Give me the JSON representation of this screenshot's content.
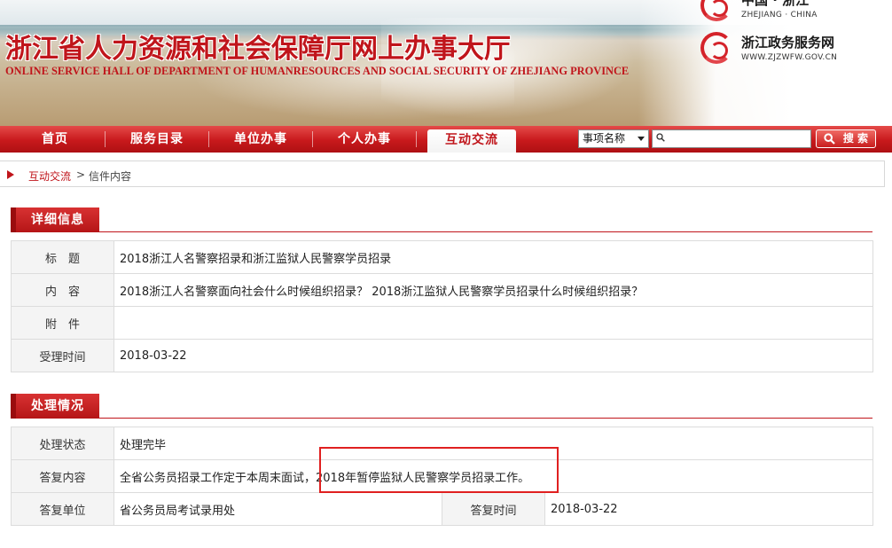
{
  "header": {
    "title_cn": "浙江省人力资源和社会保障厅网上办事大厅",
    "title_en": "ONLINE SERVICE HALL OF DEPARTMENT OF HUMANRESOURCES AND SOCIAL SECURITY OF ZHEJIANG PROVINCE",
    "logo_top": {
      "cn": "中国 · 浙江",
      "en": "ZHEJIANG · CHINA"
    },
    "logo_mid": {
      "cn": "浙江政务服务网",
      "en": "WWW.ZJZWFW.GOV.CN"
    }
  },
  "nav": {
    "items": [
      {
        "label": "首页"
      },
      {
        "label": "服务目录"
      },
      {
        "label": "单位办事"
      },
      {
        "label": "个人办事"
      },
      {
        "label": "互动交流"
      }
    ],
    "active": "互动交流",
    "search_type": "事项名称",
    "search_placeholder": "",
    "search_button": "搜 索"
  },
  "breadcrumb": {
    "link": "互动交流",
    "separator": ">",
    "current": "信件内容"
  },
  "details": {
    "section_title": "详细信息",
    "rows": [
      {
        "label": "标　题",
        "value": "2018浙江人名警察招录和浙江监狱人民警察学员招录"
      },
      {
        "label": "内　容",
        "value": "2018浙江人名警察面向社会什么时候组织招录？ 2018浙江监狱人民警察学员招录什么时候组织招录？"
      },
      {
        "label": "附　件",
        "value": ""
      },
      {
        "label": "受理时间",
        "value": "2018-03-22"
      }
    ]
  },
  "handling": {
    "section_title": "处理情况",
    "status_label": "处理状态",
    "status_value": "处理完毕",
    "reply_label": "答复内容",
    "reply_value": "全省公务员招录工作定于本周末面试，2018年暂停监狱人民警察学员招录工作。",
    "unit_label": "答复单位",
    "unit_value": "省公务员局考试录用处",
    "time_label": "答复时间",
    "time_value": "2018-03-22"
  },
  "colors": {
    "brand_red": "#c0151b",
    "highlight_box": "#e02020"
  }
}
